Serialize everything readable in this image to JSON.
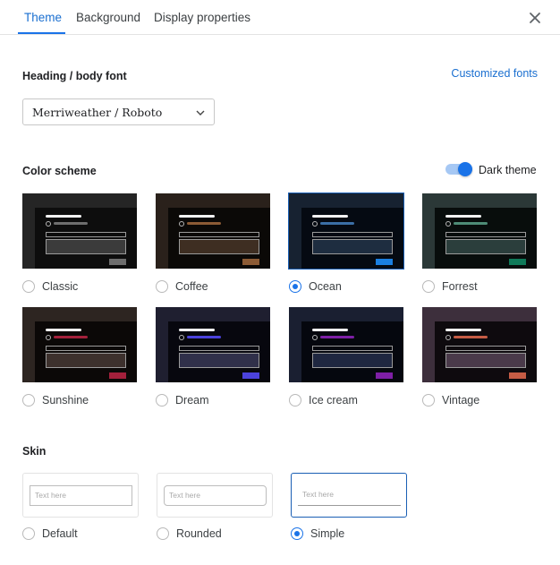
{
  "tabs": [
    {
      "label": "Theme",
      "active": true
    },
    {
      "label": "Background",
      "active": false
    },
    {
      "label": "Display properties",
      "active": false
    }
  ],
  "close_icon": "close-icon",
  "font_section": {
    "title": "Heading / body font",
    "customized_link": "Customized fonts",
    "selected_font": "Merriweather / Roboto"
  },
  "color_section": {
    "title": "Color scheme",
    "dark_theme_label": "Dark theme",
    "dark_theme_on": true,
    "schemes": [
      {
        "label": "Classic",
        "frame": "#252525",
        "inner": "#0d0d0d",
        "accent": "#6e6e6e",
        "field": "#3b3b3b",
        "btn": "#6e6e6e",
        "selected": false
      },
      {
        "label": "Coffee",
        "frame": "#2a211b",
        "inner": "#0b0907",
        "accent": "#8c5b35",
        "field": "#3e2e22",
        "btn": "#8c5b35",
        "selected": false
      },
      {
        "label": "Ocean",
        "frame": "#172231",
        "inner": "#050a12",
        "accent": "#3b6fa6",
        "field": "#1e2d40",
        "btn": "#1a7fe0",
        "selected": true
      },
      {
        "label": "Forrest",
        "frame": "#2b3837",
        "inner": "#080d0c",
        "accent": "#4e8c76",
        "field": "#2b3e3c",
        "btn": "#0f7a59",
        "selected": false
      },
      {
        "label": "Sunshine",
        "frame": "#2d2521",
        "inner": "#0b0807",
        "accent": "#a3203b",
        "field": "#3d312d",
        "btn": "#a3203b",
        "selected": false
      },
      {
        "label": "Dream",
        "frame": "#1f1f30",
        "inner": "#07070e",
        "accent": "#4b42dc",
        "field": "#30304a",
        "btn": "#4b42dc",
        "selected": false
      },
      {
        "label": "Ice cream",
        "frame": "#1a1f31",
        "inner": "#05070e",
        "accent": "#7e1fa6",
        "field": "#1f2740",
        "btn": "#7e1fa6",
        "selected": false
      },
      {
        "label": "Vintage",
        "frame": "#3d2f3c",
        "inner": "#0e0a0e",
        "accent": "#c55c45",
        "field": "#4a3a4a",
        "btn": "#c55c45",
        "selected": false
      }
    ]
  },
  "skin_section": {
    "title": "Skin",
    "placeholder": "Text here",
    "skins": [
      {
        "label": "Default",
        "style": "square",
        "selected": false
      },
      {
        "label": "Rounded",
        "style": "rounded",
        "selected": false
      },
      {
        "label": "Simple",
        "style": "simple",
        "selected": true
      }
    ]
  },
  "colors": {
    "accent": "#1a73e8",
    "link": "#1a6fd0"
  }
}
